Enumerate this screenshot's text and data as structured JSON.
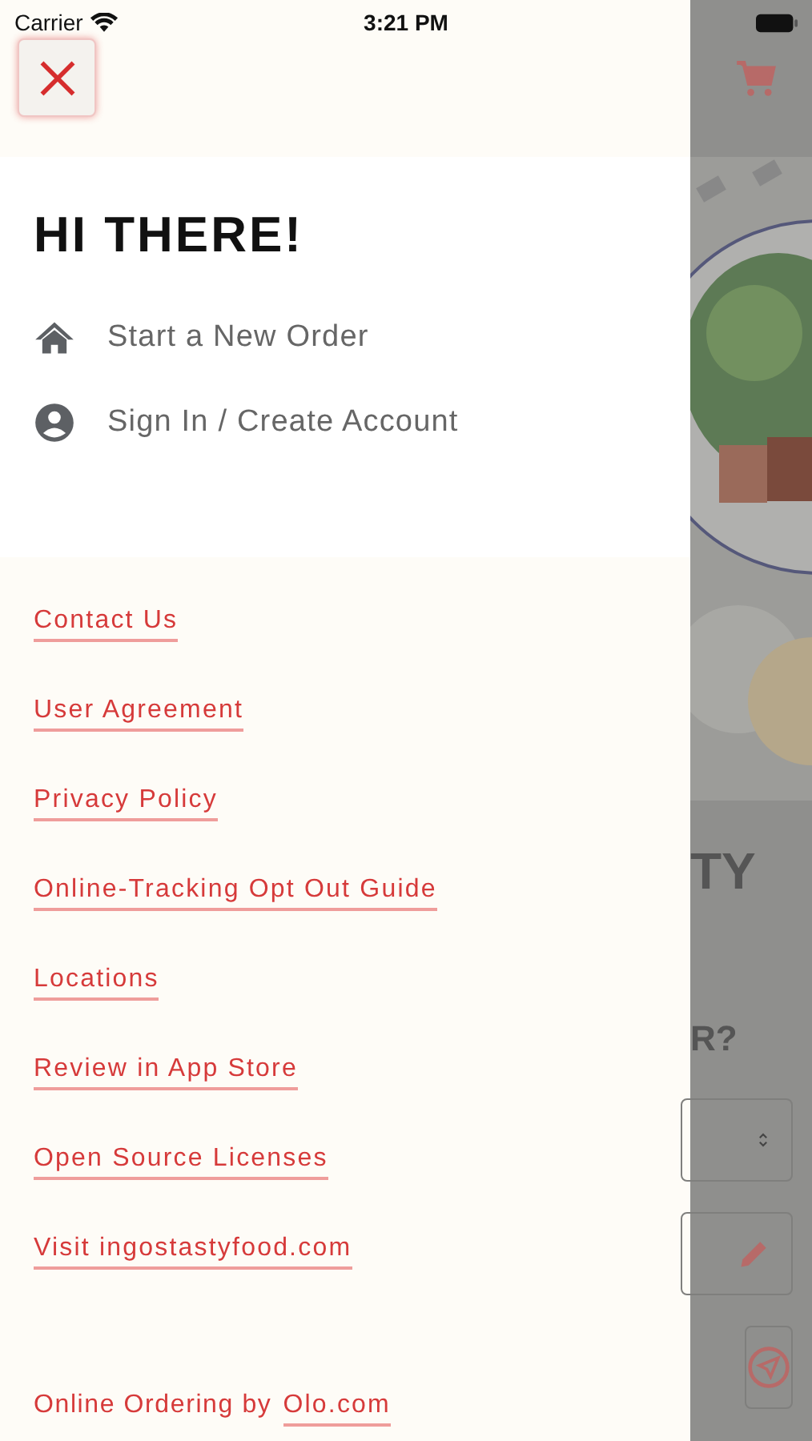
{
  "status_bar": {
    "carrier": "Carrier",
    "time": "3:21 PM"
  },
  "drawer": {
    "greeting": "HI THERE!",
    "menu": [
      {
        "kind": "home",
        "label": "Start a New Order"
      },
      {
        "kind": "account",
        "label": "Sign In / Create Account"
      }
    ],
    "links": [
      "Contact Us",
      "User Agreement",
      "Privacy Policy",
      "Online-Tracking Opt Out Guide",
      "Locations",
      "Review in App Store",
      "Open Source Licenses",
      "Visit ingostastyfood.com"
    ],
    "footer": {
      "text": "Online Ordering by",
      "link": "Olo.com"
    }
  },
  "background": {
    "heading_fragment": "TY",
    "question_fragment": "R?"
  }
}
